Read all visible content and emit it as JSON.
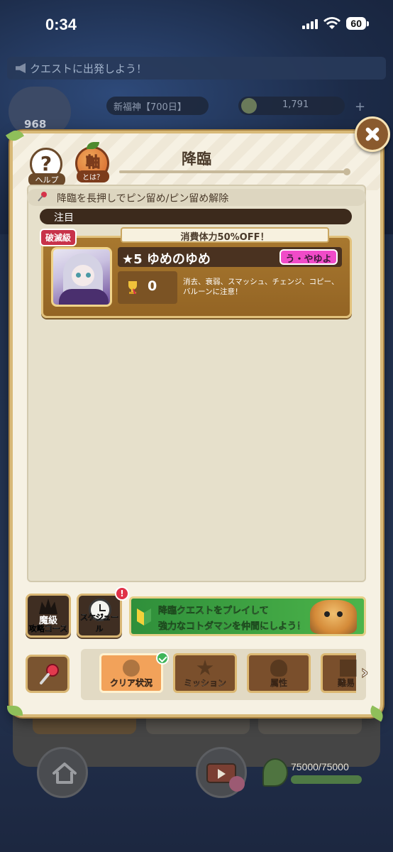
{
  "status_bar": {
    "time": "0:34",
    "battery": "60"
  },
  "background": {
    "quest_banner": "クエストに出発しよう！",
    "rank_number": "968",
    "event_pill": "新福神【700日】",
    "coins": "1,791",
    "stamina_text": "75000/75000",
    "stamina_fraction": 1.0
  },
  "modal": {
    "title": "降臨",
    "help_label": "ヘルプ",
    "axis_kanji": "軸",
    "axis_label": "とは？",
    "pin_hint": "降臨を長押しでピン留め/ピン留め解除",
    "featured_label": "注目",
    "quest": {
      "difficulty_tag": "破滅級",
      "stamina_sale": "消費体力50%OFF！",
      "name": "★5 ゆめのゆめ",
      "attribute": "う・やゆよ",
      "clear_count": "0",
      "warning": "消去、衰弱、スマッシュ、チェンジ、コピー、バルーンに注意！"
    },
    "buttons": {
      "boss_kanji": "魔級",
      "boss_label": "攻略コース",
      "schedule_label": "スケジュール",
      "schedule_badge": "!"
    },
    "promo": {
      "line1": "降臨クエストをプレイして",
      "line2": "強力なコトダマンを仲間にしよう！"
    },
    "tabs": [
      {
        "label": "クリア状況",
        "active": true
      },
      {
        "label": "ミッション",
        "active": false
      },
      {
        "label": "属性",
        "active": false
      },
      {
        "label": "難易",
        "active": false
      }
    ]
  },
  "colors": {
    "accent": "#f2a25a",
    "panel": "#f6f1e3",
    "frame": "#d8b978"
  }
}
